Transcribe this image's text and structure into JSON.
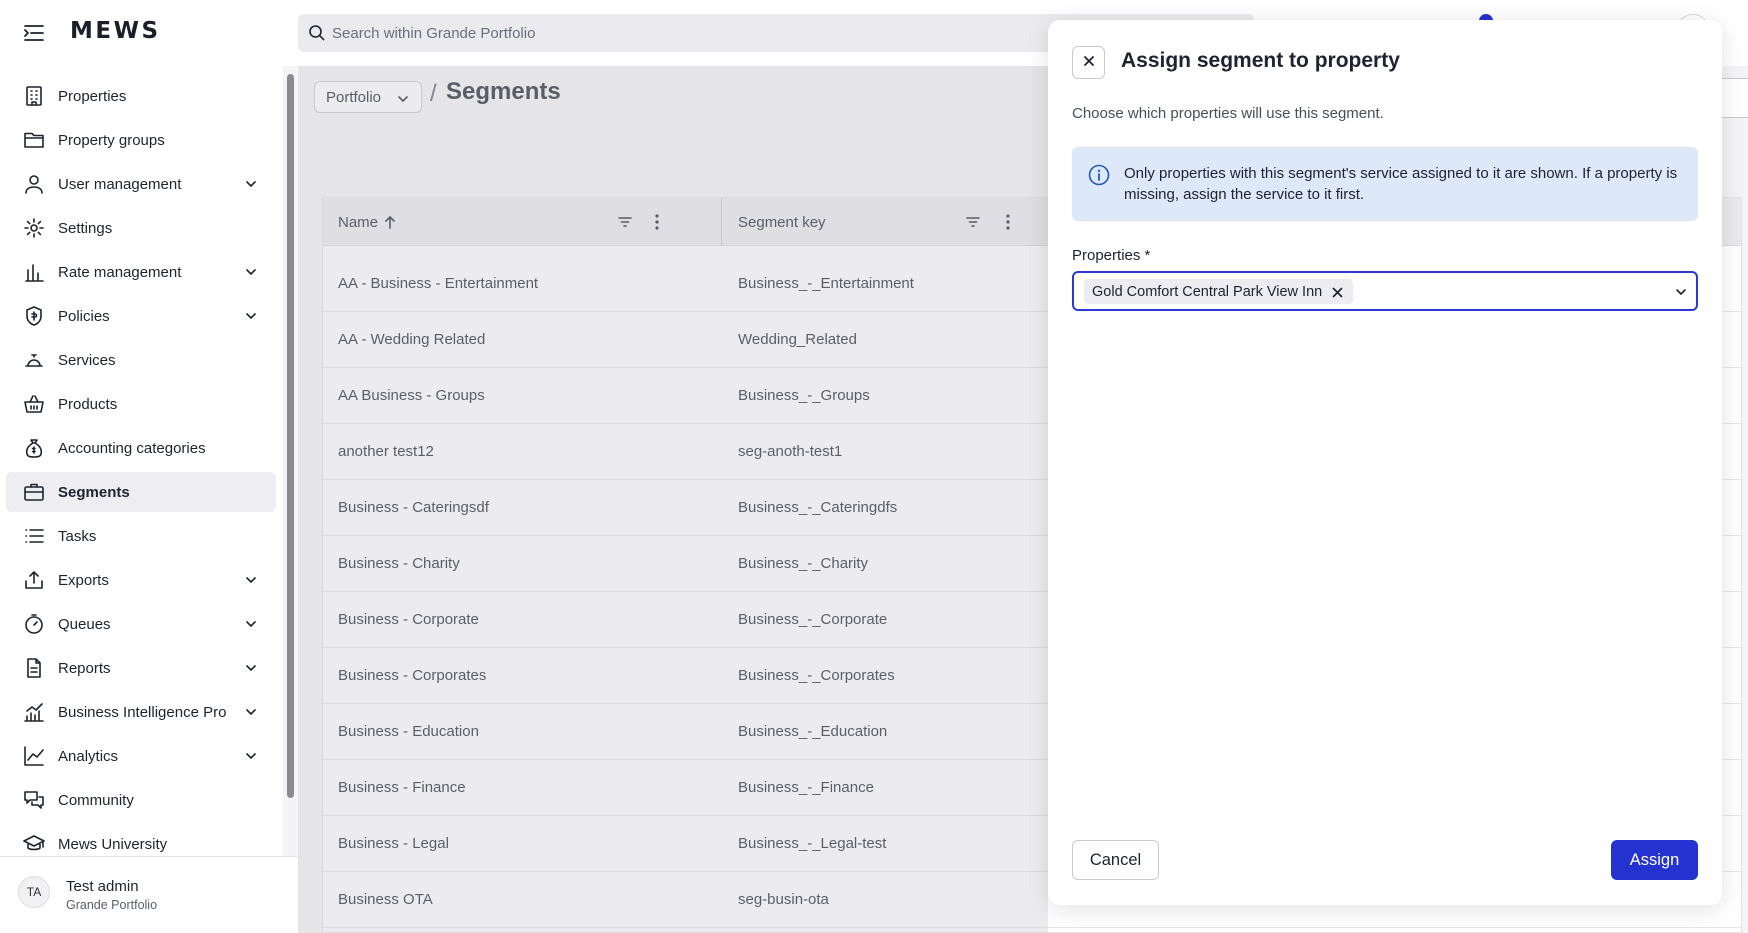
{
  "app": {
    "logo": "MEWS"
  },
  "search": {
    "placeholder": "Search within Grande Portfolio"
  },
  "sidebar": {
    "items": [
      {
        "label": "Properties",
        "icon": "building-icon",
        "expandable": false
      },
      {
        "label": "Property groups",
        "icon": "folder-icon",
        "expandable": false
      },
      {
        "label": "User management",
        "icon": "user-icon",
        "expandable": true
      },
      {
        "label": "Settings",
        "icon": "gear-icon",
        "expandable": false
      },
      {
        "label": "Rate management",
        "icon": "bar-chart-icon",
        "expandable": true
      },
      {
        "label": "Policies",
        "icon": "shield-icon",
        "expandable": true
      },
      {
        "label": "Services",
        "icon": "bell-icon",
        "expandable": false
      },
      {
        "label": "Products",
        "icon": "basket-icon",
        "expandable": false
      },
      {
        "label": "Accounting categories",
        "icon": "money-bag-icon",
        "expandable": false
      },
      {
        "label": "Segments",
        "icon": "briefcase-icon",
        "expandable": false,
        "active": true
      },
      {
        "label": "Tasks",
        "icon": "list-icon",
        "expandable": false
      },
      {
        "label": "Exports",
        "icon": "export-icon",
        "expandable": true
      },
      {
        "label": "Queues",
        "icon": "timer-icon",
        "expandable": true
      },
      {
        "label": "Reports",
        "icon": "document-icon",
        "expandable": true
      },
      {
        "label": "Business Intelligence Pro",
        "icon": "bi-chart-icon",
        "expandable": true
      },
      {
        "label": "Analytics",
        "icon": "line-chart-icon",
        "expandable": true
      },
      {
        "label": "Community",
        "icon": "chat-icon",
        "expandable": false
      },
      {
        "label": "Mews University",
        "icon": "graduation-cap-icon",
        "expandable": false
      }
    ]
  },
  "user": {
    "initials": "TA",
    "name": "Test admin",
    "org": "Grande Portfolio"
  },
  "main": {
    "breadcrumb_root": "Portfolio",
    "breadcrumb_sep": "/",
    "title": "Segments",
    "table": {
      "columns": [
        "Name",
        "Segment key"
      ],
      "rows": [
        {
          "name": "AA - Business - Entertainment",
          "key": "Business_-_Entertainment"
        },
        {
          "name": "AA - Wedding Related",
          "key": "Wedding_Related"
        },
        {
          "name": "AA Business - Groups",
          "key": "Business_-_Groups"
        },
        {
          "name": "another test12",
          "key": "seg-anoth-test1"
        },
        {
          "name": "Business - Cateringsdf",
          "key": "Business_-_Cateringdfs"
        },
        {
          "name": "Business - Charity",
          "key": "Business_-_Charity"
        },
        {
          "name": "Business - Corporate",
          "key": "Business_-_Corporate"
        },
        {
          "name": "Business - Corporates",
          "key": "Business_-_Corporates"
        },
        {
          "name": "Business - Education",
          "key": "Business_-_Education"
        },
        {
          "name": "Business - Finance",
          "key": "Business_-_Finance"
        },
        {
          "name": "Business - Legal",
          "key": "Business_-_Legal-test"
        },
        {
          "name": "Business OTA",
          "key": "seg-busin-ota"
        }
      ]
    }
  },
  "panel": {
    "title": "Assign segment to property",
    "subtitle": "Choose which properties will use this segment.",
    "info": "Only properties with this segment's service assigned to it are shown. If a property is missing, assign the service to it first.",
    "field_label": "Properties *",
    "selected": [
      "Gold Comfort Central Park View Inn"
    ],
    "cancel_label": "Cancel",
    "assign_label": "Assign"
  },
  "colors": {
    "accent": "#2432d0",
    "info_bg": "#dde9f8",
    "active_nav_bg": "#ededf2"
  }
}
